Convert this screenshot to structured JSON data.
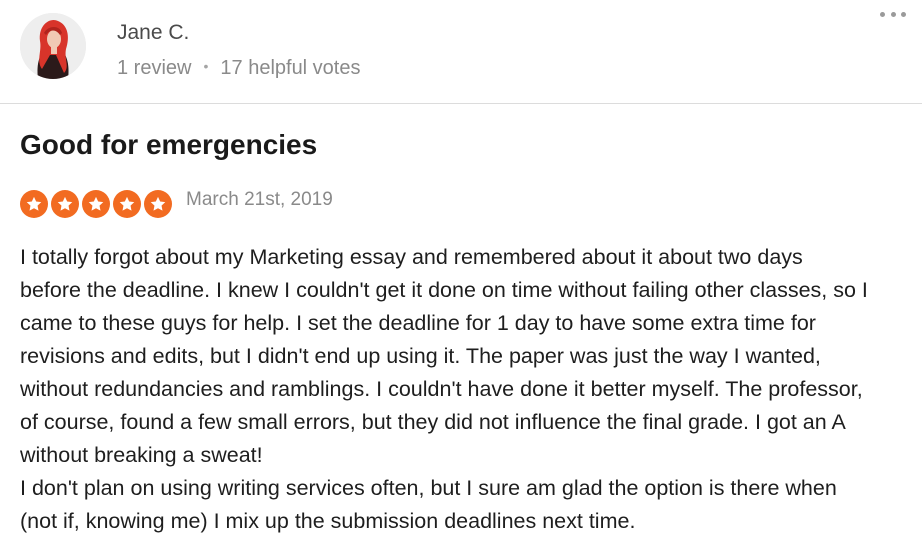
{
  "review": {
    "reviewer": {
      "name": "Jane C.",
      "review_count": "1 review",
      "separator": "•",
      "helpful_votes": "17 helpful votes"
    },
    "title": "Good for emergencies",
    "rating": {
      "value": 5,
      "max": 5,
      "color": "#f26b21"
    },
    "date": "March 21st, 2019",
    "body_lines": [
      "I totally forgot about my Marketing essay and remembered about it about two days",
      "before the deadline. I knew I couldn't get it done on time without failing other classes, so I",
      "came to these guys for help. I set the deadline for 1 day to have some extra time for",
      "revisions and edits, but I didn't end up using it. The paper was just the way I wanted,",
      "without redundancies and ramblings. I couldn't have done it better myself. The professor,",
      "of course, found a few small errors, but they did not influence the final grade. I got an A",
      "without breaking a sweat!",
      "I don't plan on using writing services often, but I sure am glad the option is there when",
      "(not if, knowing me) I mix up the submission deadlines next time."
    ]
  },
  "icons": {
    "more": "more-options-icon",
    "star": "star-icon",
    "avatar": "user-avatar"
  }
}
